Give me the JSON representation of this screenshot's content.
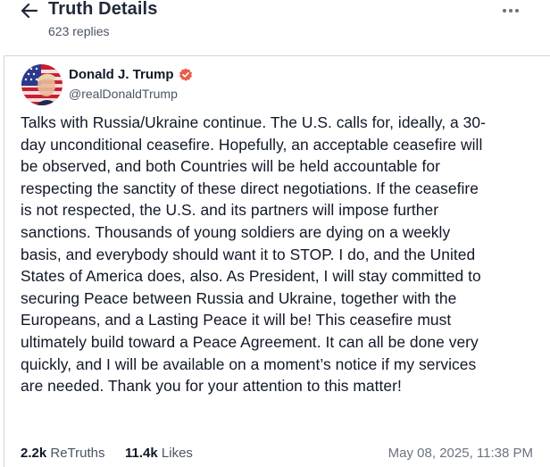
{
  "header": {
    "title": "Truth Details",
    "replies": "623 replies",
    "back_icon": "arrow-left-icon",
    "more_icon": "more-horizontal-icon"
  },
  "post": {
    "author_name": "Donald J. Trump",
    "verified_icon": "verified-badge-icon",
    "verified_color": "#e85d4a",
    "handle": "@realDonaldTrump",
    "body_lines": [
      "Talks with Russia/Ukraine continue. The U.S. calls for, ideally, a 30-",
      "day unconditional ceasefire. Hopefully, an acceptable ceasefire will",
      "be observed, and both Countries will be held accountable for",
      "respecting the sanctity of these direct negotiations. If the ceasefire",
      "is not respected, the U.S. and its partners will impose further",
      "sanctions. Thousands of young soldiers are dying on a weekly",
      "basis, and everybody should want it to STOP. I do, and the United",
      "States of America does, also. As President, I will stay committed to",
      "securing Peace between Russia and Ukraine, together with the",
      "Europeans, and a Lasting Peace it will be! This ceasefire must",
      "ultimately build toward a Peace Agreement. It can all be done very",
      "quickly, and I will be available on a moment’s notice if my services",
      "are needed. Thank you for your attention to this matter!"
    ],
    "retruths_count": "2.2k",
    "retruths_label": "ReTruths",
    "likes_count": "11.4k",
    "likes_label": "Likes",
    "timestamp": "May 08, 2025, 11:38 PM"
  }
}
